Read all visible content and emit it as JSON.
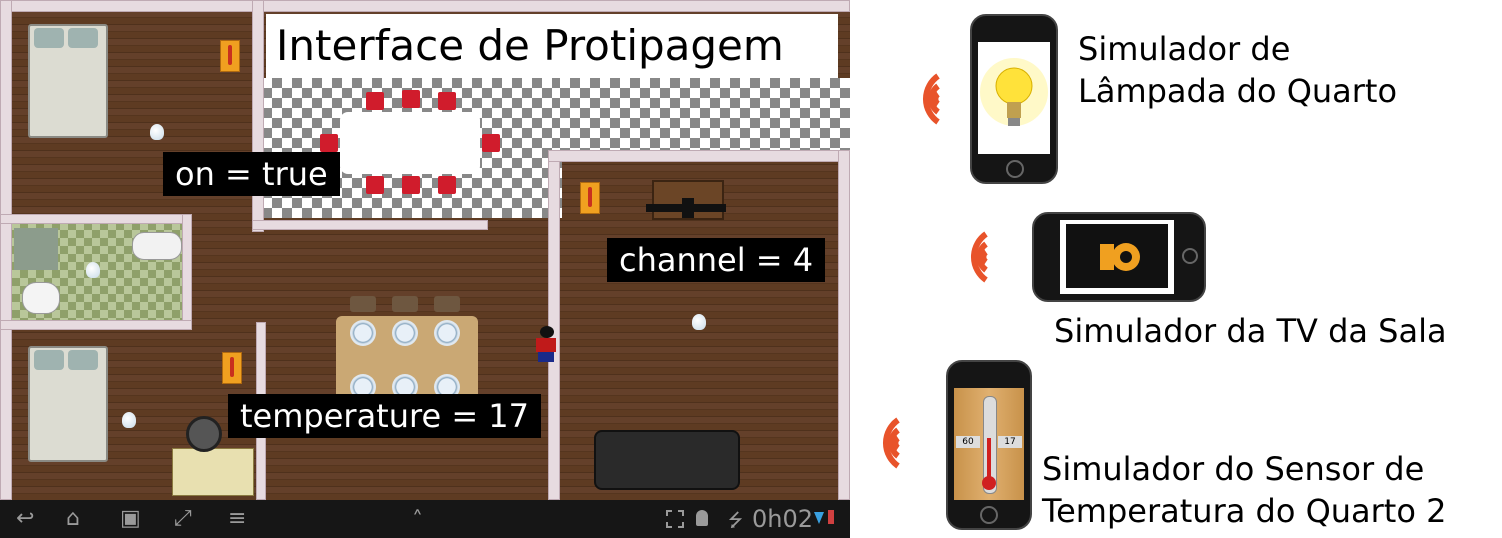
{
  "floorplan": {
    "title": "Interface de Protipagem",
    "labels": {
      "lamp": "on = true",
      "tv": "channel = 4",
      "temperature": "temperature = 17"
    }
  },
  "navbar": {
    "back_icon": "↩",
    "home_icon": "⌂",
    "recent_icon": "▣",
    "screenshot_icon": "⤢",
    "menu_icon": "≡",
    "up_icon": "˄",
    "clock": "0h02"
  },
  "devices": {
    "lamp_caption_line1": "Simulador de",
    "lamp_caption_line2": "Lâmpada do Quarto",
    "tv_caption": "Simulador da TV da Sala",
    "sensor_caption_line1": "Simulador do Sensor de",
    "sensor_caption_line2": "Temperatura do Quarto 2",
    "thermometer_left": "60",
    "thermometer_right": "17"
  },
  "colors": {
    "wave": "#e8532a",
    "label_bg": "#000000",
    "label_text": "#ffffff"
  }
}
